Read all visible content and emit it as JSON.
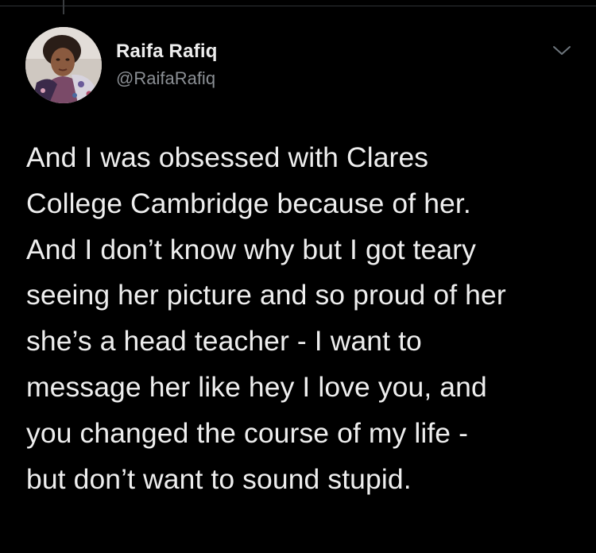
{
  "tweet": {
    "author": {
      "display_name": "Raifa Rafiq",
      "handle": "@RaifaRafiq",
      "avatar_icon": "profile-photo"
    },
    "menu_icon": "chevron-down-icon",
    "text_lines": [
      "And I was obsessed with Clares",
      "College Cambridge because of her.",
      "And I don’t know why but I got teary",
      "seeing her picture and so proud of her",
      "she’s a head teacher - I want to",
      "message her like hey I love you, and",
      "you changed the course of my life -",
      "but don’t want to sound stupid."
    ]
  },
  "colors": {
    "background": "#000000",
    "text": "#eeeeee",
    "handle": "#8b8f94",
    "divider": "#2f3336"
  }
}
